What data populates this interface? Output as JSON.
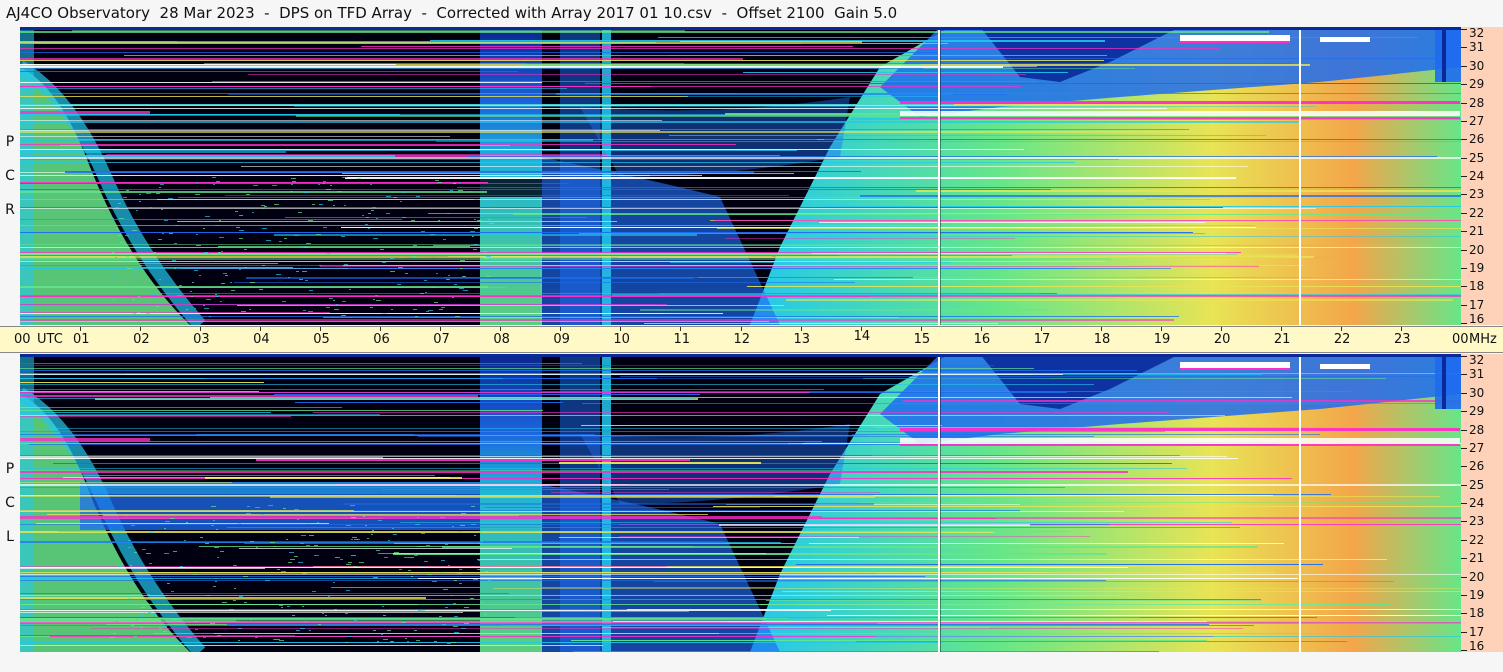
{
  "header": {
    "title": "AJ4CO Observatory  28 Mar 2023  -  DPS on TFD Array  -  Corrected with Array 2017 01 10.csv  -  Offset 2100  Gain 5.0"
  },
  "panels": {
    "top": {
      "side_letters": [
        "R",
        "C",
        "P"
      ]
    },
    "bottom": {
      "side_letters": [
        "L",
        "C",
        "P"
      ]
    }
  },
  "time_axis": {
    "start_label": "00",
    "utc_label": "UTC",
    "hour_labels": [
      "01",
      "02",
      "03",
      "04",
      "05",
      "06",
      "07",
      "08",
      "09",
      "10",
      "11",
      "12",
      "13",
      "14",
      "15",
      "16",
      "17",
      "18",
      "19",
      "20",
      "21",
      "22",
      "23"
    ],
    "end_label": "00",
    "unit_label": "MHz"
  },
  "freq_axis": {
    "labels": [
      "32",
      "31",
      "30",
      "29",
      "28",
      "27",
      "26",
      "25",
      "24",
      "23",
      "22",
      "21",
      "20",
      "19",
      "18",
      "17",
      "16"
    ]
  },
  "colors": {
    "background_dark": "#000010",
    "deep_blue": "#0a2a9a",
    "blue": "#1e6cf0",
    "cyan": "#22c8ee",
    "green": "#66e688",
    "yellow": "#e8e455",
    "orange": "#f3a64a",
    "magenta": "#ff2ec8",
    "white_line": "#ffffff",
    "axis_bg": "#fff9c7",
    "tick_bg": "#fdd2b8"
  }
}
